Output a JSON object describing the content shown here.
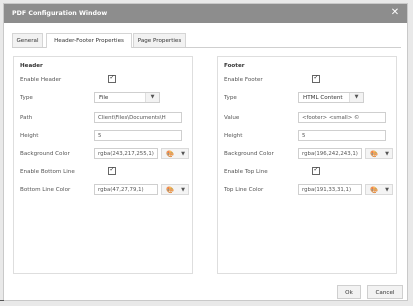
{
  "window": {
    "title": "PDF Configuration Window",
    "close_glyph": "✕"
  },
  "tabs": [
    {
      "label": "General",
      "active": false
    },
    {
      "label": "Header-Footer Properties",
      "active": true
    },
    {
      "label": "Page Properties",
      "active": false
    }
  ],
  "header": {
    "title": "Header",
    "enable_label": "Enable Header",
    "enable_checked": true,
    "type_label": "Type",
    "type_value": "File",
    "path_label": "Path",
    "path_value": "Client\\Files\\Documents\\H",
    "height_label": "Height",
    "height_value": "5",
    "bg_label": "Background Color",
    "bg_value": "rgba(243,217,255,1)",
    "bg_swatch": "#f3d9ff",
    "bottom_line_label": "Enable Bottom Line",
    "bottom_line_checked": true,
    "line_color_label": "Bottom Line Color",
    "line_color_value": "rgba(47,27,79,1)",
    "line_swatch": "#2f1b4f"
  },
  "footer": {
    "title": "Footer",
    "enable_label": "Enable Footer",
    "enable_checked": true,
    "type_label": "Type",
    "type_value": "HTML Content",
    "value_label": "Value",
    "value_value": "<footer>   <small>    ©",
    "height_label": "Height",
    "height_value": "5",
    "bg_label": "Background Color",
    "bg_value": "rgba(196,242,243,1)",
    "bg_swatch": "#c4f2f3",
    "top_line_label": "Enable Top Line",
    "top_line_checked": true,
    "line_color_label": "Top Line Color",
    "line_color_value": "rgba(191,33,31,1)",
    "line_swatch": "#bf211f"
  },
  "buttons": {
    "ok": "Ok",
    "cancel": "Cancel"
  },
  "icons": {
    "checkbox_tick": "✓",
    "dropdown": "▼",
    "palette": "🎨"
  }
}
